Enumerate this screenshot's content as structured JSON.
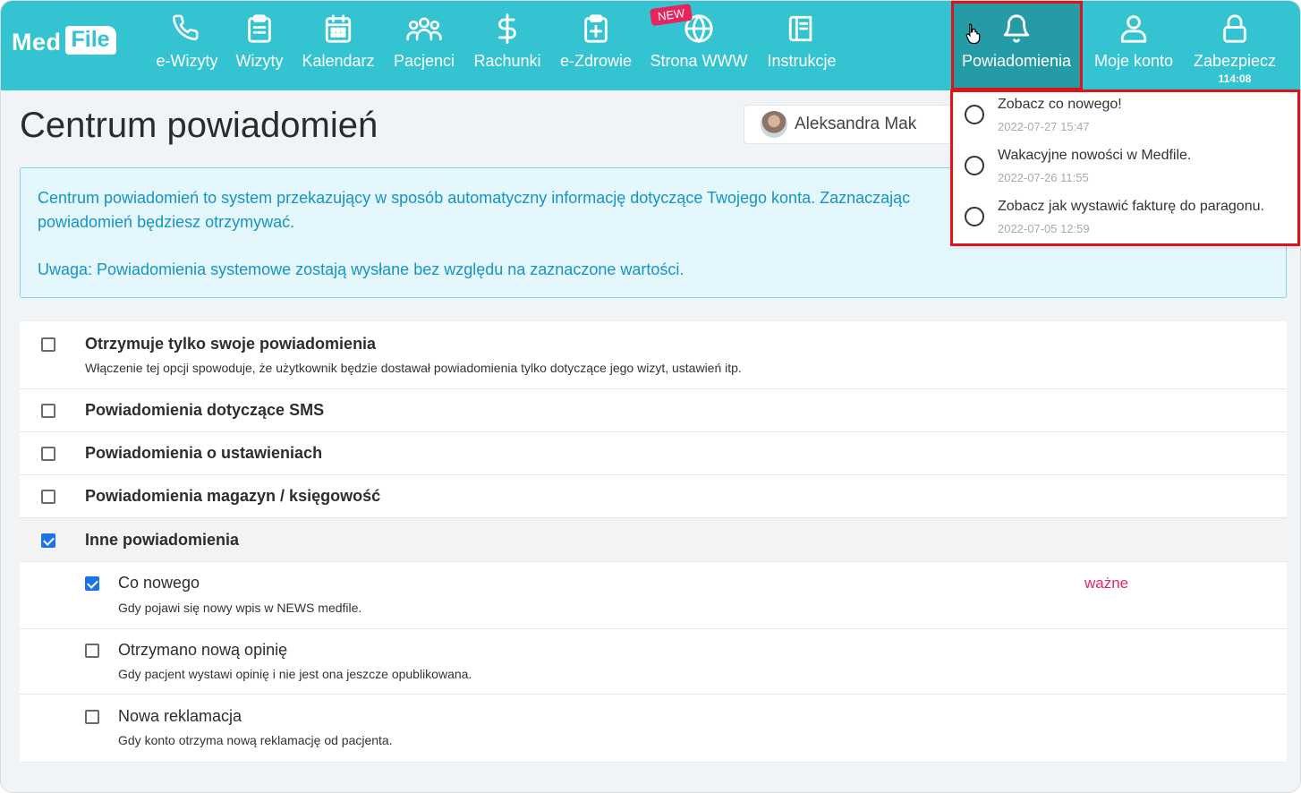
{
  "app": {
    "logo_left": "Med",
    "logo_right": "File",
    "new_badge": "NEW"
  },
  "nav": {
    "items": [
      {
        "label": "e-Wizyty",
        "icon": "phone-icon"
      },
      {
        "label": "Wizyty",
        "icon": "clipboard-list-icon"
      },
      {
        "label": "Kalendarz",
        "icon": "calendar-icon"
      },
      {
        "label": "Pacjenci",
        "icon": "users-icon"
      },
      {
        "label": "Rachunki",
        "icon": "dollar-icon"
      },
      {
        "label": "e-Zdrowie",
        "icon": "medical-clipboard-icon"
      },
      {
        "label": "Strona WWW",
        "icon": "globe-icon"
      },
      {
        "label": "Instrukcje",
        "icon": "book-icon"
      },
      {
        "label": "Powiadomienia",
        "icon": "bell-icon"
      },
      {
        "label": "Moje konto",
        "icon": "user-icon"
      },
      {
        "label": "Zabezpiecz",
        "icon": "lock-icon",
        "sub": "114:08"
      }
    ],
    "active": "Powiadomienia"
  },
  "page": {
    "title": "Centrum powiadomień",
    "user_name": "Aleksandra Mak",
    "info_line1": "Centrum powiadomień to system przekazujący w sposób automatyczny informację dotyczące Twojego konta. Zaznaczając",
    "info_line2": "powiadomień będziesz otrzymywać.",
    "info_line3": "Uwaga: Powiadomienia systemowe zostają wysłane bez względu na zaznaczone wartości."
  },
  "settings": {
    "rows": [
      {
        "title": "Otrzymuje tylko swoje powiadomienia",
        "desc": "Włączenie tej opcji spowoduje, że użytkownik będzie dostawał powiadomienia tylko dotyczące jego wizyt, ustawień itp.",
        "checked": false
      },
      {
        "title": "Powiadomienia dotyczące SMS",
        "checked": false
      },
      {
        "title": "Powiadomienia o ustawieniach",
        "checked": false
      },
      {
        "title": "Powiadomienia magazyn / księgowość",
        "checked": false
      },
      {
        "title": "Inne powiadomienia",
        "checked": true
      },
      {
        "title": "Co nowego",
        "desc": "Gdy pojawi się nowy wpis w NEWS medfile.",
        "tag": "ważne",
        "checked": true
      },
      {
        "title": "Otrzymano nową opinię",
        "desc": "Gdy pacjent wystawi opinię i nie jest ona jeszcze opublikowana.",
        "checked": false
      },
      {
        "title": "Nowa reklamacja",
        "desc": "Gdy konto otrzyma nową reklamację od pacjenta.",
        "checked": false
      }
    ]
  },
  "dropdown": {
    "items": [
      {
        "title": "Zobacz co nowego!",
        "date": "2022-07-27 15:47"
      },
      {
        "title": "Wakacyjne nowości w Medfile.",
        "date": "2022-07-26 11:55"
      },
      {
        "title": "Zobacz jak wystawić fakturę do paragonu.",
        "date": "2022-07-05 12:59"
      }
    ]
  },
  "colors": {
    "nav_bg": "#34c3d0",
    "nav_active": "#259ba5",
    "info_text": "#1494c7",
    "tag": "#e6245e",
    "highlight": "#e0121b"
  }
}
